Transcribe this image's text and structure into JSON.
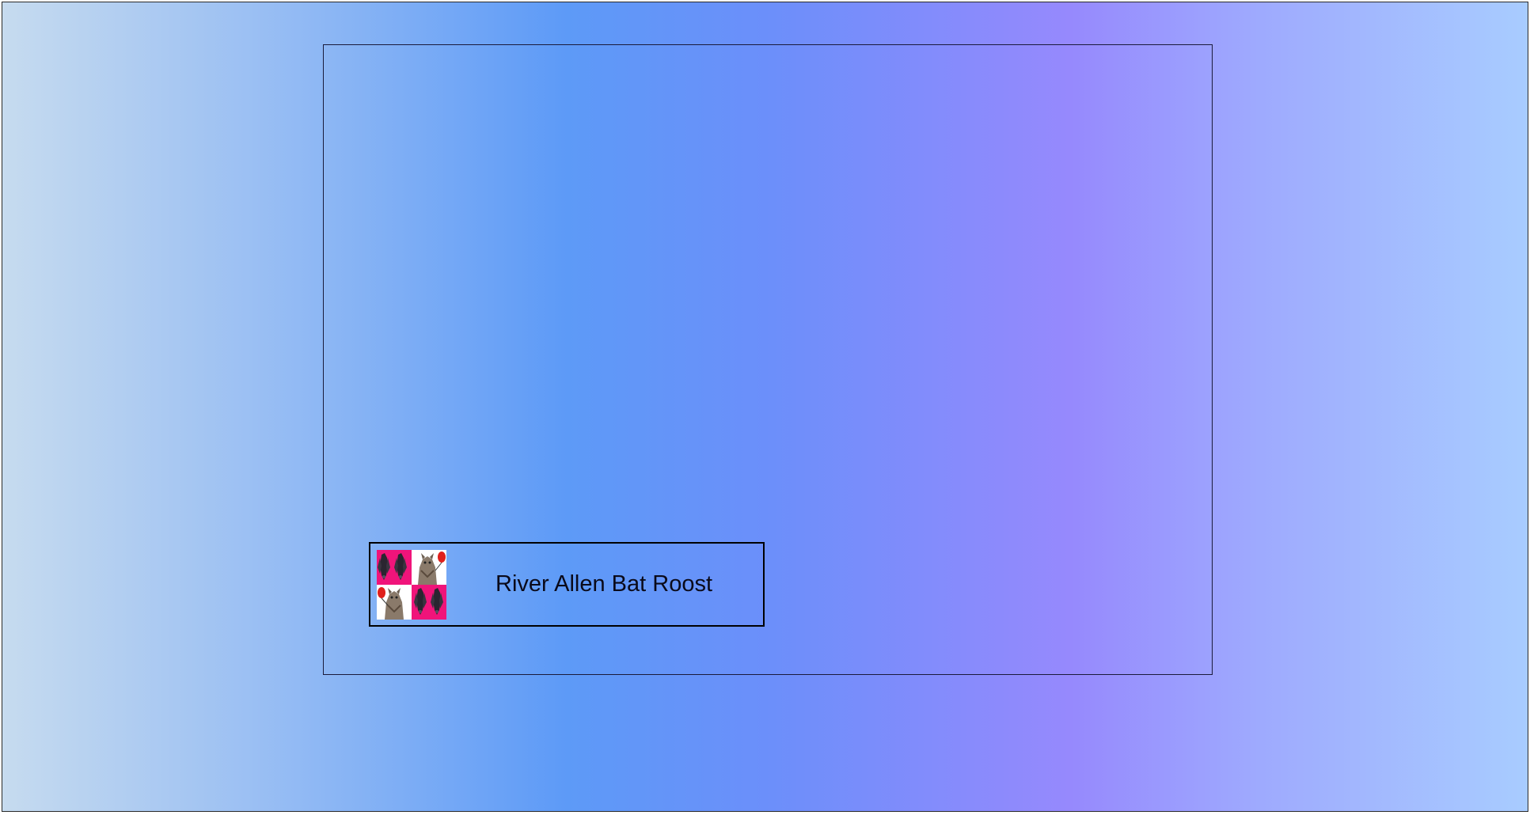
{
  "colors": {
    "gradient_left": "#c6dbef",
    "gradient_mid_blue": "#5d9af7",
    "gradient_mid_violet": "#9689fd",
    "gradient_right": "#a8ccff",
    "tile_magenta": "#f0147a",
    "tile_white": "#ffffff"
  },
  "roost": {
    "label": "River Allen Bat Roost",
    "logo_icon": "bat-roost-logo-icon",
    "tiles": [
      {
        "icon": "hanging-bats-icon",
        "background": "magenta"
      },
      {
        "icon": "furry-bat-with-red-balloon-icon",
        "background": "white"
      },
      {
        "icon": "furry-bat-with-red-balloon-icon",
        "background": "white"
      },
      {
        "icon": "hanging-bats-icon",
        "background": "magenta"
      }
    ]
  }
}
